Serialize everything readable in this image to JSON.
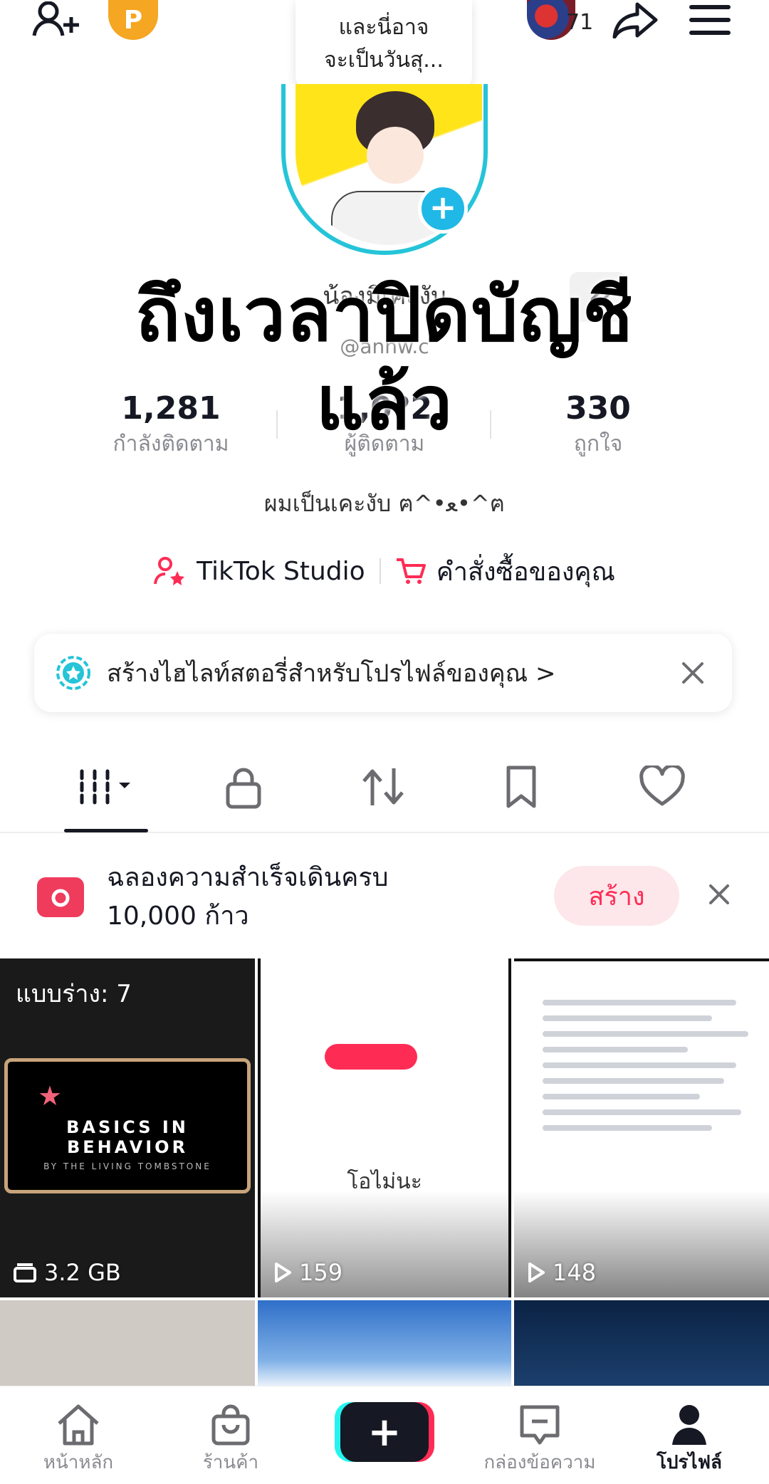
{
  "header": {
    "note_line1": "และนี่อาจ",
    "note_line2": "จะเป็นวันสุ...",
    "coin_label": "P",
    "friends_count": "71",
    "icons": [
      "add-friend-icon",
      "share-icon",
      "menu-icon"
    ]
  },
  "overlay": {
    "line1": "ถึงเวลาปิดบัญชี",
    "line2": "แล้ว"
  },
  "profile": {
    "display_name": "น้องมิเคะงับ",
    "username": "@annw.c"
  },
  "stats": [
    {
      "value": "1,281",
      "label": "กำลังติดตาม"
    },
    {
      "value": "1,0?2",
      "label": "ผู้ติดตาม"
    },
    {
      "value": "330",
      "label": "ถูกใจ"
    }
  ],
  "bio": "ผมเป็นเคะงับ ฅ^•ﻌ•^ฅ",
  "links": {
    "studio": "TikTok Studio",
    "orders": "คำสั่งซื้อของคุณ"
  },
  "highlight": {
    "text": "สร้างไฮไลท์สตอรี่สำหรับโปรไฟล์ของคุณ >"
  },
  "milestone": {
    "line1": "ฉลองความสำเร็จเดินครบ",
    "line2": "10,000 ก้าว",
    "button": "สร้าง"
  },
  "grid": {
    "draft_label": "แบบร่าง: 7",
    "cell1_meta": "3.2 GB",
    "cell2_meta": "159",
    "cell3_meta": "148",
    "cell2_text": "โอไม่นะ",
    "basics_title": "BASICS IN BEHAVIOR",
    "basics_sub": "BY THE LIVING TOMBSTONE"
  },
  "bottom_nav": {
    "home": "หน้าหลัก",
    "shop": "ร้านค้า",
    "inbox": "กล่องข้อความ",
    "profile": "โปรไฟล์"
  },
  "colors": {
    "accent": "#fe2c55",
    "cyan": "#25f4ee",
    "text": "#161823",
    "muted": "#8a8b91"
  }
}
